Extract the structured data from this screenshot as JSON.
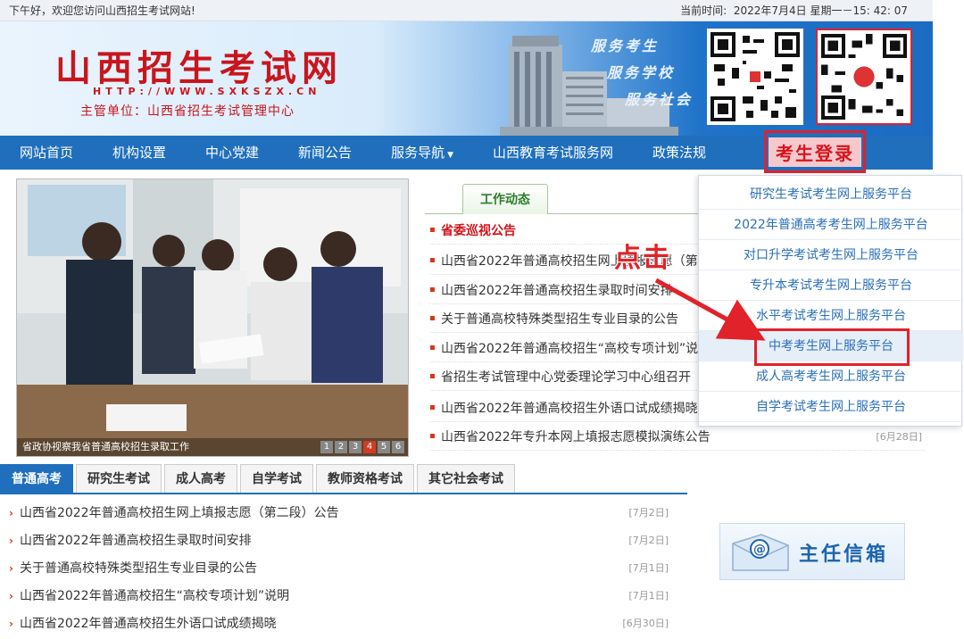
{
  "topbar": {
    "greeting": "下午好，欢迎您访问山西招生考试网站!",
    "time_label": "当前时间:",
    "time_value": "2022年7月4日 星期一－15: 42: 07"
  },
  "header": {
    "title": "山西招生考试网",
    "url": "HTTP://WWW.SXKSZX.CN",
    "subtitle": "主管单位：山西省招生考试管理中心",
    "slogans": [
      "服务考生",
      "服务学校",
      "服务社会"
    ]
  },
  "nav": {
    "items": [
      "网站首页",
      "机构设置",
      "中心党建",
      "新闻公告",
      "服务导航",
      "山西教育考试服务网",
      "政策法规"
    ],
    "dropdown_caret": "▼"
  },
  "photo": {
    "caption": "省政协视察我省普通高校招生录取工作",
    "pages": [
      "1",
      "2",
      "3",
      "4",
      "5",
      "6"
    ],
    "active_page": 4
  },
  "news": {
    "tab_label": "工作动态",
    "items": [
      {
        "text": "省委巡视公告",
        "date": "",
        "hot": true
      },
      {
        "text": "山西省2022年普通高校招生网上填报志愿（第",
        "date": ""
      },
      {
        "text": "山西省2022年普通高校招生录取时间安排",
        "date": ""
      },
      {
        "text": "关于普通高校特殊类型招生专业目录的公告",
        "date": ""
      },
      {
        "text": "山西省2022年普通高校招生“高校专项计划”说",
        "date": ""
      },
      {
        "text": "省招生考试管理中心党委理论学习中心组召开",
        "date": ""
      },
      {
        "text": "山西省2022年普通高校招生外语口试成绩揭晓",
        "date": ""
      },
      {
        "text": "山西省2022年专升本网上填报志愿模拟演练公告",
        "date": "[6月28日]"
      }
    ]
  },
  "login": {
    "label": "考生登录",
    "menu": [
      "研究生考试考生网上服务平台",
      "2022年普通高考考生网上服务平台",
      "对口升学考试考生网上服务平台",
      "专升本考试考生网上服务平台",
      "水平考试考生网上服务平台",
      "中考考生网上服务平台",
      "成人高考考生网上服务平台",
      "自学考试考生网上服务平台"
    ],
    "highlight_index": 5
  },
  "annotation": {
    "text": "点击",
    "color": "#e1222a"
  },
  "exam_tabs": {
    "tabs": [
      "普通高考",
      "研究生考试",
      "成人高考",
      "自学考试",
      "教师资格考试",
      "其它社会考试"
    ],
    "active": 0,
    "list": [
      {
        "text": "山西省2022年普通高校招生网上填报志愿（第二段）公告",
        "date": "[7月2日]"
      },
      {
        "text": "山西省2022年普通高校招生录取时间安排",
        "date": "[7月2日]"
      },
      {
        "text": "关于普通高校特殊类型招生专业目录的公告",
        "date": "[7月1日]"
      },
      {
        "text": "山西省2022年普通高校招生“高校专项计划”说明",
        "date": "[7月1日]"
      },
      {
        "text": "山西省2022年普通高校招生外语口试成绩揭晓",
        "date": "[6月30日]"
      }
    ]
  },
  "mailbox": {
    "label": "主任信箱",
    "icon": "mail-at-icon"
  },
  "colors": {
    "brand_red": "#c8161d",
    "nav_blue": "#1f6fbd",
    "accent_green": "#2b7d2b"
  }
}
